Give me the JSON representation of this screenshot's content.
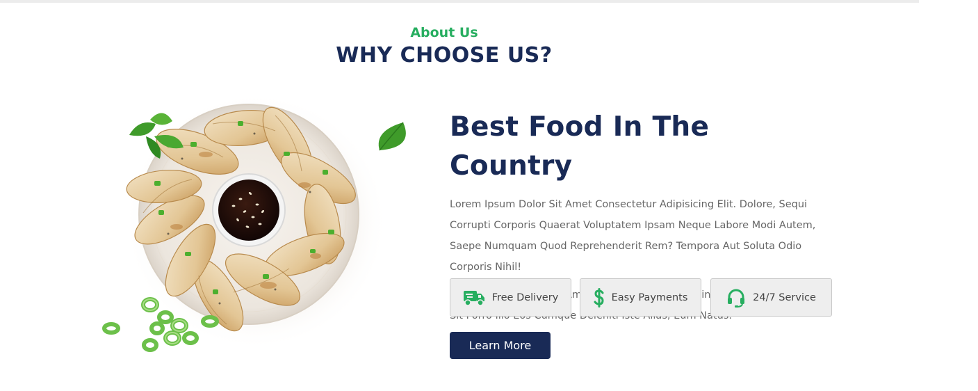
{
  "header": {
    "eyebrow": "About Us",
    "title": "WHY CHOOSE US?"
  },
  "content": {
    "title": "Best Food In The Country",
    "paragraph_1": "Lorem Ipsum Dolor Sit Amet Consectetur Adipisicing Elit. Dolore, Sequi Corrupti Corporis Quaerat Voluptatem Ipsam Neque Labore Modi Autem, Saepe Numquam Quod Reprehenderit Rem? Tempora Aut Soluta Odio Corporis Nihil!",
    "paragraph_2": "Lorem Ipsum Dolor Sit Amet, Consectetur Adipisicing Elit. Aperiam, Nemo. Sit Porro Illo Eos Cumque Deleniti Iste Alias, Eum Natus."
  },
  "badges": [
    {
      "label": "Free Delivery",
      "icon": "truck-icon"
    },
    {
      "label": "Easy Payments",
      "icon": "dollar-icon"
    },
    {
      "label": "24/7 Service",
      "icon": "headset-icon"
    }
  ],
  "button": {
    "label": "Learn More"
  },
  "colors": {
    "accent_green": "#27ae60",
    "navy": "#192a56",
    "body_text": "#666666",
    "badge_bg": "#eeeeee"
  }
}
